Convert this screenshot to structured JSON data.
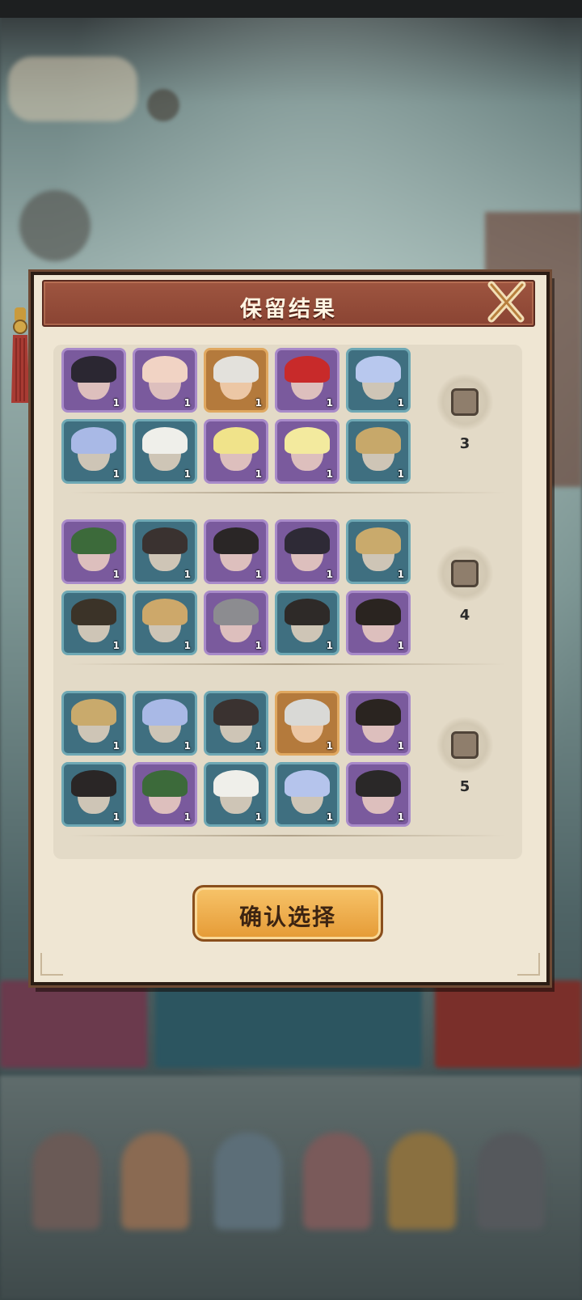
{
  "dialog": {
    "title": "保留结果",
    "confirm_label": "确认选择",
    "close_icon": "close-x-icon"
  },
  "groups": [
    {
      "label": "3",
      "checked": false,
      "heroes": [
        {
          "rarity": "purple",
          "hair": "#2b2732",
          "count": "1"
        },
        {
          "rarity": "purple",
          "hair": "#f1d3c4",
          "count": "1"
        },
        {
          "rarity": "gold",
          "hair": "#e3e1dc",
          "count": "1"
        },
        {
          "rarity": "purple",
          "hair": "#c82a2a",
          "count": "1"
        },
        {
          "rarity": "blue",
          "hair": "#b8c8ee",
          "count": "1"
        },
        {
          "rarity": "blue",
          "hair": "#a9b9e6",
          "count": "1"
        },
        {
          "rarity": "blue",
          "hair": "#efefea",
          "count": "1"
        },
        {
          "rarity": "purple",
          "hair": "#f0e38a",
          "count": "1"
        },
        {
          "rarity": "purple",
          "hair": "#f3ea9e",
          "count": "1"
        },
        {
          "rarity": "blue",
          "hair": "#c7a86a",
          "count": "1"
        }
      ]
    },
    {
      "label": "4",
      "checked": false,
      "heroes": [
        {
          "rarity": "purple",
          "hair": "#3c6a3a",
          "count": "1"
        },
        {
          "rarity": "blue",
          "hair": "#3a3230",
          "count": "1"
        },
        {
          "rarity": "purple",
          "hair": "#2a2626",
          "count": "1"
        },
        {
          "rarity": "purple",
          "hair": "#2e2a36",
          "count": "1"
        },
        {
          "rarity": "blue",
          "hair": "#c9aa6c",
          "count": "1"
        },
        {
          "rarity": "blue",
          "hair": "#3b3328",
          "count": "1"
        },
        {
          "rarity": "blue",
          "hair": "#cda86a",
          "count": "1"
        },
        {
          "rarity": "purple",
          "hair": "#8c8c90",
          "count": "1"
        },
        {
          "rarity": "blue",
          "hair": "#2e2a28",
          "count": "1"
        },
        {
          "rarity": "purple",
          "hair": "#2a2420",
          "count": "1"
        }
      ]
    },
    {
      "label": "5",
      "checked": false,
      "heroes": [
        {
          "rarity": "blue",
          "hair": "#c9aa6c",
          "count": "1"
        },
        {
          "rarity": "blue",
          "hair": "#a9b9e6",
          "count": "1"
        },
        {
          "rarity": "blue",
          "hair": "#3a3230",
          "count": "1"
        },
        {
          "rarity": "gold",
          "hair": "#d9d9d6",
          "count": "1"
        },
        {
          "rarity": "purple",
          "hair": "#2a2420",
          "count": "1"
        },
        {
          "rarity": "blue",
          "hair": "#2a2626",
          "count": "1"
        },
        {
          "rarity": "purple",
          "hair": "#3c6a3a",
          "count": "1"
        },
        {
          "rarity": "blue",
          "hair": "#efefea",
          "count": "1"
        },
        {
          "rarity": "blue",
          "hair": "#b5c4ec",
          "count": "1"
        },
        {
          "rarity": "purple",
          "hair": "#2a2828",
          "count": "1"
        }
      ]
    }
  ],
  "colors": {
    "dialog_bg": "#efe6d3",
    "header": "#9e5540",
    "button": "#f0b14f"
  }
}
